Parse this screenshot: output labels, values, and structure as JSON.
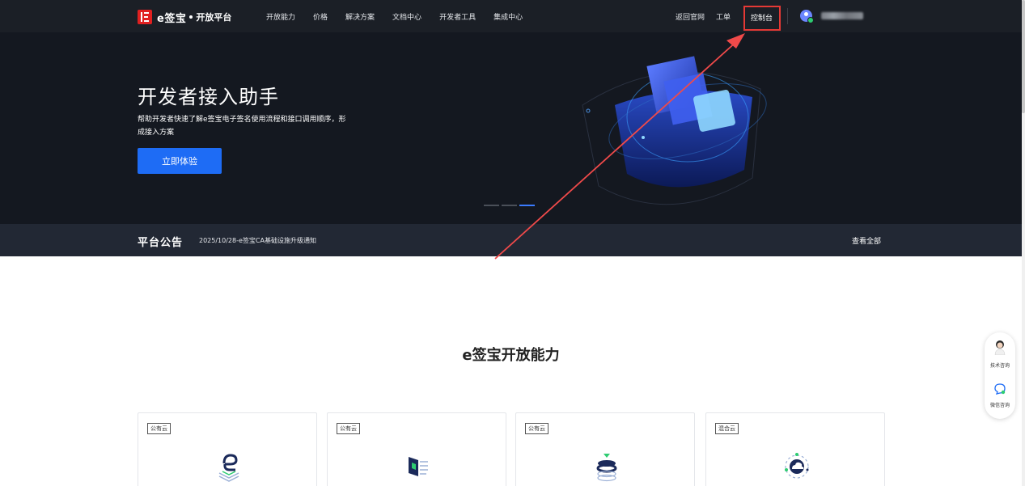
{
  "nav": {
    "brand_name": "e签宝",
    "brand_sub": "开放平台",
    "menu": [
      "开放能力",
      "价格",
      "解决方案",
      "文档中心",
      "开发者工具",
      "集成中心"
    ],
    "right": [
      "返回官网",
      "工单"
    ],
    "console": "控制台"
  },
  "hero": {
    "title": "开发者接入助手",
    "description": "帮助开发者快速了解e签宝电子签名使用流程和接口调用顺序，形成接入方案",
    "cta": "立即体验",
    "slides": 3,
    "active_slide": 3
  },
  "notice": {
    "title": "平台公告",
    "text": "2025/10/28-e签宝CA基础设施升级通知",
    "more": "查看全部"
  },
  "section": {
    "title": "e签宝开放能力"
  },
  "cards": [
    {
      "badge": "公有云",
      "icon": "e-logo-icon"
    },
    {
      "badge": "公有云",
      "icon": "document-list-icon"
    },
    {
      "badge": "公有云",
      "icon": "layer-stack-icon"
    },
    {
      "badge": "混合云",
      "icon": "cloud-orbit-icon"
    }
  ],
  "float": {
    "consult": "技术咨询",
    "wechat": "微信咨询"
  },
  "colors": {
    "nav_bg": "#1b1f26",
    "hero_bg": "#141820",
    "notice_bg": "#222834",
    "accent": "#1e6cf5",
    "highlight": "#e53935"
  }
}
